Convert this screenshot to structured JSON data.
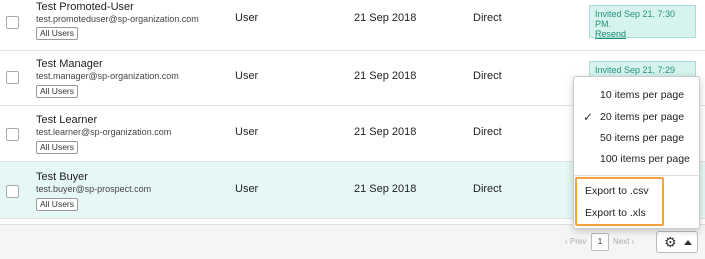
{
  "users": [
    {
      "name": "Test Promoted-User",
      "email": "test.promoteduser@sp-organization.com",
      "group": "All Users",
      "role": "User",
      "date": "21 Sep 2018",
      "type": "Direct",
      "status": "Invited Sep 21, 7:30 PM.",
      "resend": "Resend"
    },
    {
      "name": "Test Manager",
      "email": "test.manager@sp-organization.com",
      "group": "All Users",
      "role": "User",
      "date": "21 Sep 2018",
      "type": "Direct",
      "status": "Invited Sep 21, 7:29 PM."
    },
    {
      "name": "Test Learner",
      "email": "test.learner@sp-organization.com",
      "group": "All Users",
      "role": "User",
      "date": "21 Sep 2018",
      "type": "Direct"
    },
    {
      "name": "Test Buyer",
      "email": "test.buyer@sp-prospect.com",
      "group": "All Users",
      "role": "User",
      "date": "21 Sep 2018",
      "type": "Direct"
    }
  ],
  "menu": {
    "items": [
      "10 items per page",
      "20 items per page",
      "50 items per page",
      "100 items per page"
    ],
    "selected_index": 1,
    "check_glyph": "✓",
    "export_csv": "Export to .csv",
    "export_xls": "Export to .xls"
  },
  "pager": {
    "prev": "‹ Prev",
    "page": "1",
    "next": "Next ›"
  },
  "settings": {
    "icon": "gear-icon",
    "glyph": "⚙"
  },
  "colors": {
    "highlight_row": "#e6f8f5",
    "status_bg": "#d6f3ee",
    "status_text": "#26937f",
    "export_outline": "#f2a33a"
  }
}
